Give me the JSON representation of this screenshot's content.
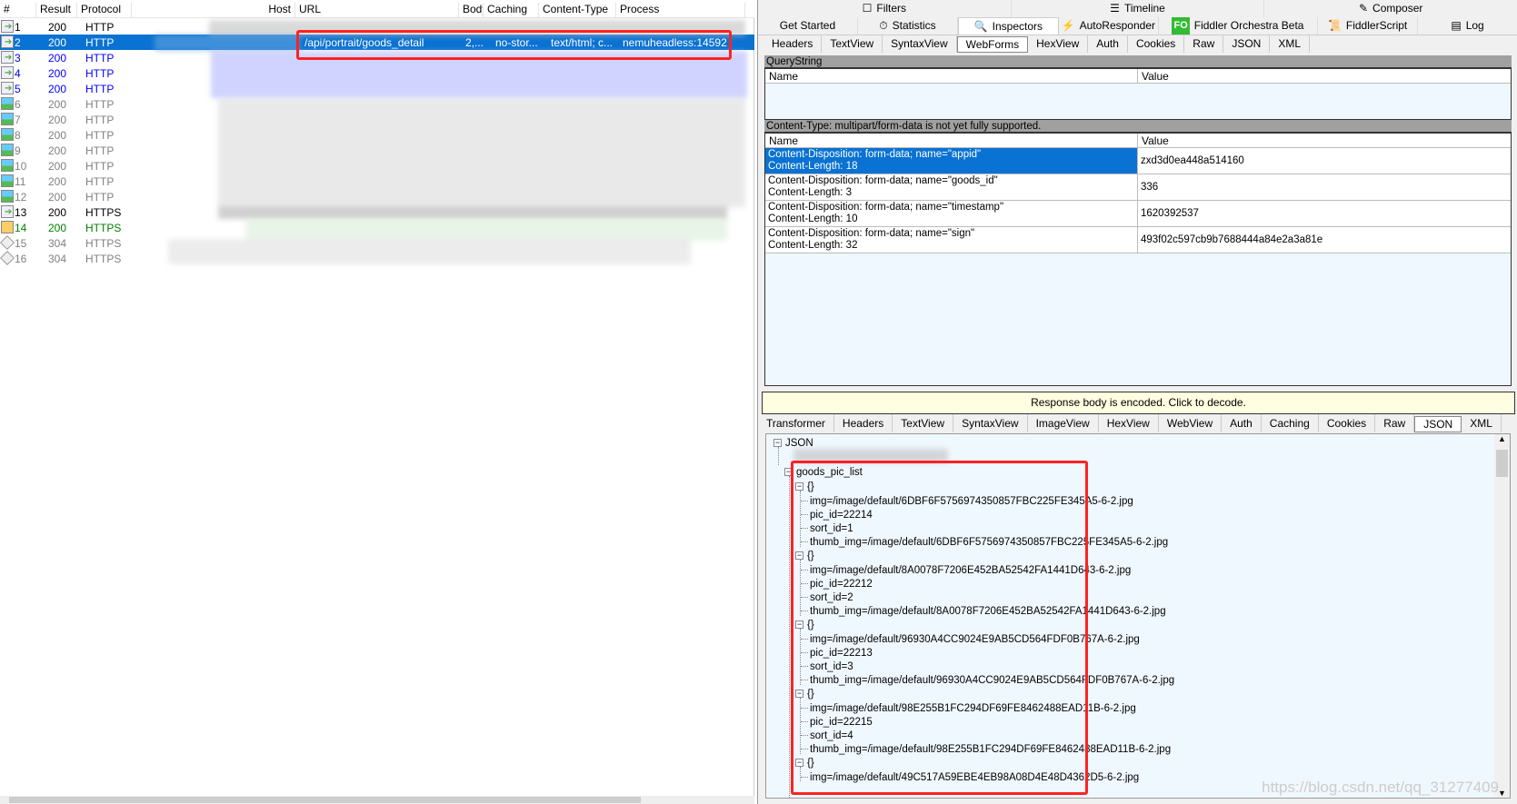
{
  "sessions": {
    "columns": [
      "#",
      "Result",
      "Protocol",
      "Host",
      "URL",
      "Body",
      "Caching",
      "Content-Type",
      "Process"
    ],
    "rows": [
      {
        "num": "1",
        "result": "200",
        "protocol": "HTTP",
        "color": "#000000",
        "icon": "request-arrow-icon"
      },
      {
        "num": "2",
        "result": "200",
        "protocol": "HTTP",
        "color": "#ffffff",
        "icon": "request-arrow-icon",
        "selected": true,
        "url": "/api/portrait/goods_detail",
        "body": "2,...",
        "caching": "no-stor...",
        "content_type": "text/html; c...",
        "process": "nemuheadless:14592"
      },
      {
        "num": "3",
        "result": "200",
        "protocol": "HTTP",
        "color": "#0000ff",
        "icon": "request-arrow-icon"
      },
      {
        "num": "4",
        "result": "200",
        "protocol": "HTTP",
        "color": "#0000ff",
        "icon": "request-arrow-icon"
      },
      {
        "num": "5",
        "result": "200",
        "protocol": "HTTP",
        "color": "#0000ff",
        "icon": "request-arrow-icon"
      },
      {
        "num": "6",
        "result": "200",
        "protocol": "HTTP",
        "color": "#808080",
        "icon": "image-icon"
      },
      {
        "num": "7",
        "result": "200",
        "protocol": "HTTP",
        "color": "#808080",
        "icon": "image-icon"
      },
      {
        "num": "8",
        "result": "200",
        "protocol": "HTTP",
        "color": "#808080",
        "icon": "image-icon"
      },
      {
        "num": "9",
        "result": "200",
        "protocol": "HTTP",
        "color": "#808080",
        "icon": "image-icon"
      },
      {
        "num": "10",
        "result": "200",
        "protocol": "HTTP",
        "color": "#808080",
        "icon": "image-icon"
      },
      {
        "num": "11",
        "result": "200",
        "protocol": "HTTP",
        "color": "#808080",
        "icon": "image-icon"
      },
      {
        "num": "12",
        "result": "200",
        "protocol": "HTTP",
        "color": "#808080",
        "icon": "image-icon"
      },
      {
        "num": "13",
        "result": "200",
        "protocol": "HTTPS",
        "color": "#000000",
        "icon": "request-arrow-icon"
      },
      {
        "num": "14",
        "result": "200",
        "protocol": "HTTPS",
        "color": "#008000",
        "icon": "script-icon"
      },
      {
        "num": "15",
        "result": "304",
        "protocol": "HTTPS",
        "color": "#808080",
        "icon": "not-modified-icon"
      },
      {
        "num": "16",
        "result": "304",
        "protocol": "HTTPS",
        "color": "#808080",
        "icon": "not-modified-icon"
      }
    ]
  },
  "top_tabs_row1": [
    {
      "label": "Filters",
      "icon": "checkbox-icon"
    },
    {
      "label": "Timeline",
      "icon": "timeline-icon"
    },
    {
      "label": "Composer",
      "icon": "composer-icon"
    }
  ],
  "top_tabs_row2": [
    {
      "label": "Get Started",
      "icon": ""
    },
    {
      "label": "Statistics",
      "icon": "stopwatch-icon"
    },
    {
      "label": "Inspectors",
      "icon": "magnifier-icon",
      "active": true
    },
    {
      "label": "AutoResponder",
      "icon": "lightning-icon"
    },
    {
      "label": "Fiddler Orchestra Beta",
      "icon": "fo-icon",
      "badge": "FO"
    },
    {
      "label": "FiddlerScript",
      "icon": "script-icon"
    },
    {
      "label": "Log",
      "icon": "log-icon"
    }
  ],
  "request_tabs": [
    "Headers",
    "TextView",
    "SyntaxView",
    "WebForms",
    "HexView",
    "Auth",
    "Cookies",
    "Raw",
    "JSON",
    "XML"
  ],
  "request_active": "WebForms",
  "querystring": {
    "title": "QueryString",
    "col_name": "Name",
    "col_value": "Value"
  },
  "formdata": {
    "title": "Content-Type: multipart/form-data is not yet fully supported.",
    "col_name": "Name",
    "col_value": "Value",
    "rows": [
      {
        "name": "Content-Disposition: form-data; name=\"appid\"",
        "length": "Content-Length: 18",
        "value": "zxd3d0ea448a514160",
        "selected": true
      },
      {
        "name": "Content-Disposition: form-data; name=\"goods_id\"",
        "length": "Content-Length: 3",
        "value": "336"
      },
      {
        "name": "Content-Disposition: form-data; name=\"timestamp\"",
        "length": "Content-Length: 10",
        "value": "1620392537"
      },
      {
        "name": "Content-Disposition: form-data; name=\"sign\"",
        "length": "Content-Length: 32",
        "value": "493f02c597cb9b7688444a84e2a3a81e"
      }
    ]
  },
  "decode_bar": "Response body is encoded. Click to decode.",
  "response_tabs": [
    "Transformer",
    "Headers",
    "TextView",
    "SyntaxView",
    "ImageView",
    "HexView",
    "WebView",
    "Auth",
    "Caching",
    "Cookies",
    "Raw",
    "JSON",
    "XML"
  ],
  "response_active": "JSON",
  "tree": {
    "root": "JSON",
    "list": "goods_pic_list",
    "object_label": "{}",
    "items": [
      [
        "img=/image/default/6DBF6F5756974350857FBC225FE345A5-6-2.jpg",
        "pic_id=22214",
        "sort_id=1",
        "thumb_img=/image/default/6DBF6F5756974350857FBC225FE345A5-6-2.jpg"
      ],
      [
        "img=/image/default/8A0078F7206E452BA52542FA1441D643-6-2.jpg",
        "pic_id=22212",
        "sort_id=2",
        "thumb_img=/image/default/8A0078F7206E452BA52542FA1441D643-6-2.jpg"
      ],
      [
        "img=/image/default/96930A4CC9024E9AB5CD564FDF0B767A-6-2.jpg",
        "pic_id=22213",
        "sort_id=3",
        "thumb_img=/image/default/96930A4CC9024E9AB5CD564FDF0B767A-6-2.jpg"
      ],
      [
        "img=/image/default/98E255B1FC294DF69FE8462488EAD11B-6-2.jpg",
        "pic_id=22215",
        "sort_id=4",
        "thumb_img=/image/default/98E255B1FC294DF69FE8462488EAD11B-6-2.jpg"
      ],
      [
        "img=/image/default/49C517A59EBE4EB98A08D4E48D4362D5-6-2.jpg"
      ]
    ]
  },
  "watermark": "https://blog.csdn.net/qq_31277409",
  "colors": {
    "selection": "#0a72d2",
    "annotation": "#ff2222",
    "decode_bar": "#fefee0"
  }
}
